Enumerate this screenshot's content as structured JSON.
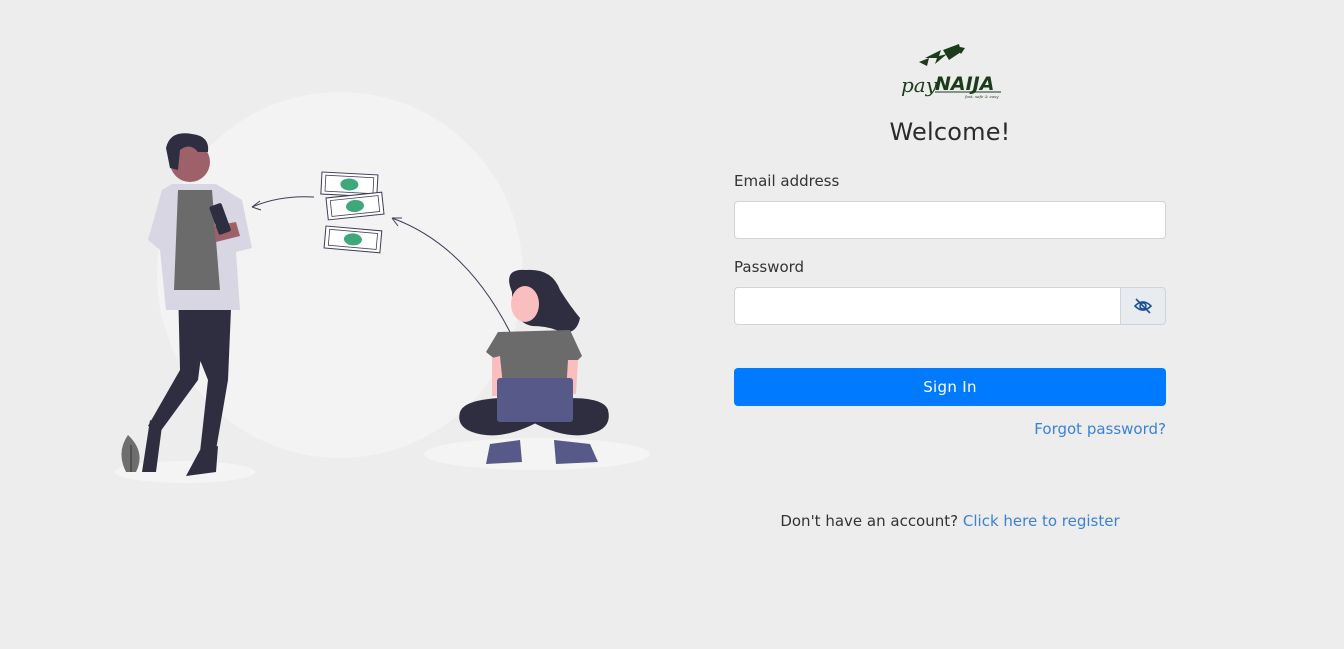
{
  "brand": {
    "logo_text_left": "pay",
    "logo_text_right": "NAIJA",
    "logo_tagline": "fast, safe & easy",
    "logo_color": "#1c3b1a"
  },
  "login": {
    "title": "Welcome!",
    "email_label": "Email address",
    "email_value": "",
    "password_label": "Password",
    "password_value": "",
    "password_toggle_icon": "eye-slash-icon",
    "signin_label": "Sign In",
    "forgot_label": "Forgot password?",
    "register_prompt": "Don't have an account?",
    "register_link": "Click here to register"
  },
  "colors": {
    "page_background": "#ededed",
    "primary_button": "#007bff",
    "link": "#3b82d6"
  }
}
